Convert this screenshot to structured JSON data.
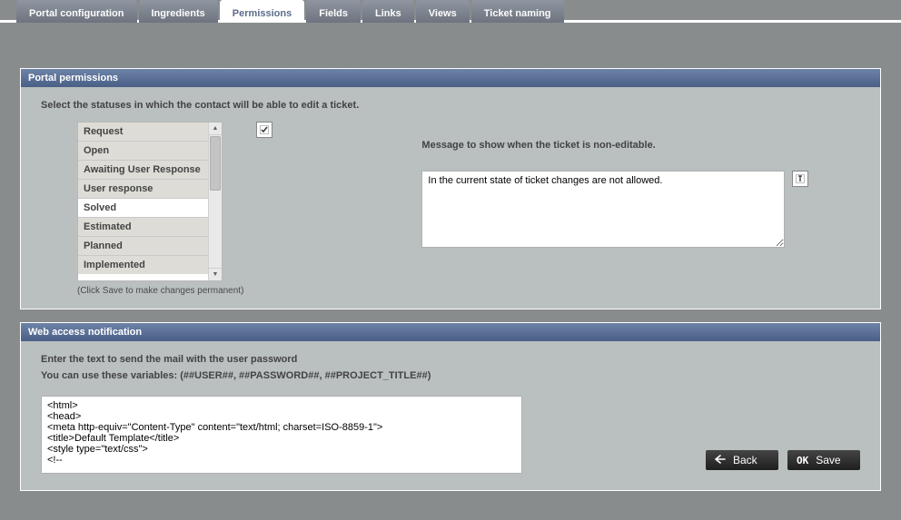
{
  "tabs": [
    {
      "label": "Portal configuration"
    },
    {
      "label": "Ingredients"
    },
    {
      "label": "Permissions"
    },
    {
      "label": "Fields"
    },
    {
      "label": "Links"
    },
    {
      "label": "Views"
    },
    {
      "label": "Ticket naming"
    }
  ],
  "active_tab_index": 2,
  "sections": {
    "permissions": {
      "title": "Portal permissions",
      "prompt": "Select the statuses in which the contact will be able to edit a ticket.",
      "hint": "(Click Save to make changes permanent)",
      "statuses": [
        {
          "label": "Request",
          "selected": true
        },
        {
          "label": "Open",
          "selected": true
        },
        {
          "label": "Awaiting User Response",
          "selected": true
        },
        {
          "label": "User response",
          "selected": true
        },
        {
          "label": "Solved",
          "selected": false
        },
        {
          "label": "Estimated",
          "selected": true
        },
        {
          "label": "Planned",
          "selected": true
        },
        {
          "label": "Implemented",
          "selected": true
        }
      ],
      "message_label": "Message to show when the ticket is non-editable.",
      "message_value": "In the current state of ticket changes are not allowed."
    },
    "web_access": {
      "title": "Web access notification",
      "line1": "Enter the text to send the mail with the user password",
      "line2": "You can use these variables: (##USER##, ##PASSWORD##, ##PROJECT_TITLE##)",
      "template_value": "<html>\n<head>\n<meta http-equiv=\"Content-Type\" content=\"text/html; charset=ISO-8859-1\">\n<title>Default Template</title>\n<style type=\"text/css\">\n<!--"
    }
  },
  "buttons": {
    "back": "Back",
    "save": "Save"
  }
}
